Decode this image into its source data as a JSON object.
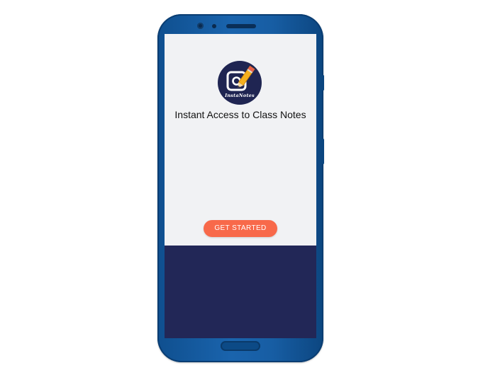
{
  "app": {
    "logo_text": "InstaNotes",
    "logo_icon": "camera-pencil-icon",
    "tagline": "Instant Access to Class Notes",
    "cta_label": "GET STARTED"
  },
  "colors": {
    "phone_body": "#1a64ad",
    "screen_top_bg": "#f1f2f4",
    "screen_bottom_bg": "#222757",
    "logo_bg": "#1f2552",
    "cta_bg": "#f8694a",
    "cta_text": "#ffffff",
    "pencil": "#f5b01e",
    "pencil_tip": "#e8604c"
  }
}
